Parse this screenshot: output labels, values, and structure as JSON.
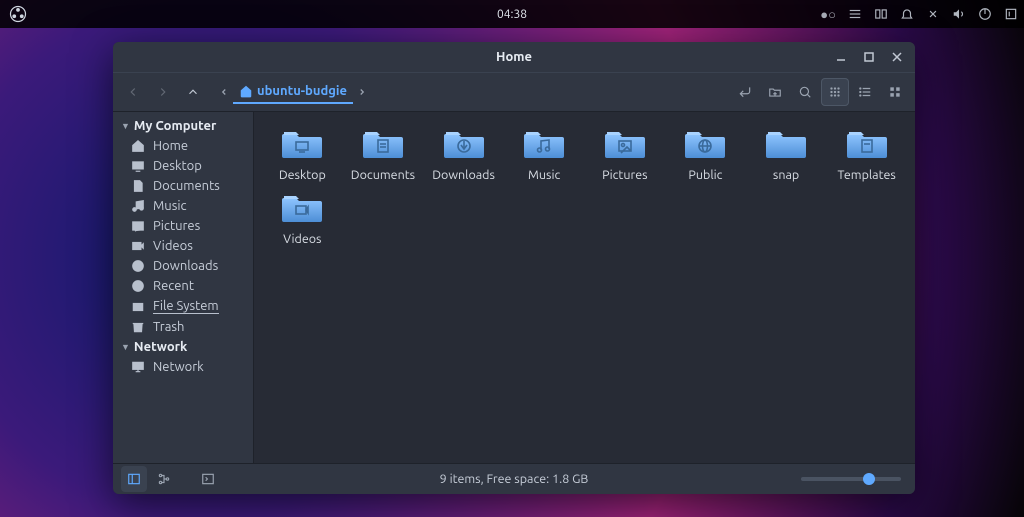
{
  "panel": {
    "clock": "04:38"
  },
  "window": {
    "title": "Home",
    "path_segment": "ubuntu-budgie"
  },
  "sidebar": {
    "sections": [
      {
        "label": "My Computer",
        "items": [
          {
            "label": "Home",
            "icon": "home"
          },
          {
            "label": "Desktop",
            "icon": "desktop"
          },
          {
            "label": "Documents",
            "icon": "documents"
          },
          {
            "label": "Music",
            "icon": "music"
          },
          {
            "label": "Pictures",
            "icon": "pictures"
          },
          {
            "label": "Videos",
            "icon": "videos"
          },
          {
            "label": "Downloads",
            "icon": "downloads"
          },
          {
            "label": "Recent",
            "icon": "recent"
          },
          {
            "label": "File System",
            "icon": "filesystem",
            "underline": true
          },
          {
            "label": "Trash",
            "icon": "trash"
          }
        ]
      },
      {
        "label": "Network",
        "items": [
          {
            "label": "Network",
            "icon": "network"
          }
        ]
      }
    ]
  },
  "folders": [
    {
      "label": "Desktop",
      "glyph": "desktop"
    },
    {
      "label": "Documents",
      "glyph": "documents"
    },
    {
      "label": "Downloads",
      "glyph": "downloads"
    },
    {
      "label": "Music",
      "glyph": "music"
    },
    {
      "label": "Pictures",
      "glyph": "pictures"
    },
    {
      "label": "Public",
      "glyph": "public"
    },
    {
      "label": "snap",
      "glyph": "plain"
    },
    {
      "label": "Templates",
      "glyph": "templates"
    },
    {
      "label": "Videos",
      "glyph": "videos"
    }
  ],
  "status": "9 items, Free space: 1.8 GB"
}
